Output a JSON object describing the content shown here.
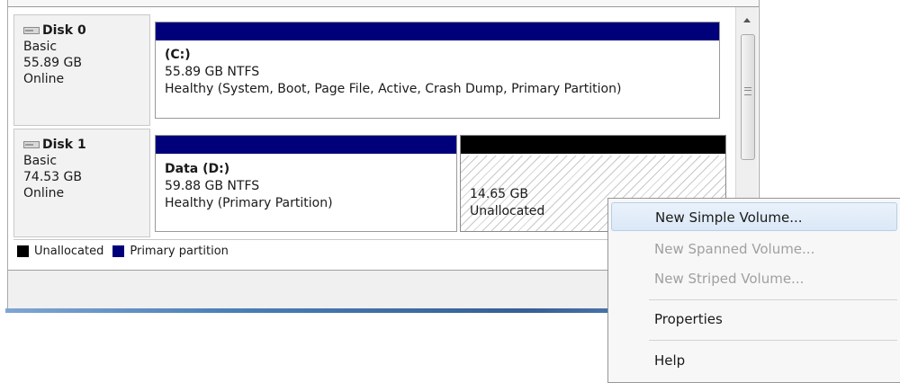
{
  "disks": [
    {
      "name": "Disk 0",
      "type": "Basic",
      "size": "55.89 GB",
      "status": "Online",
      "partitions": [
        {
          "title": "(C:)",
          "line2": "55.89 GB NTFS",
          "line3": "Healthy (System, Boot, Page File, Active, Crash Dump, Primary Partition)",
          "kind": "primary"
        }
      ]
    },
    {
      "name": "Disk 1",
      "type": "Basic",
      "size": "74.53 GB",
      "status": "Online",
      "partitions": [
        {
          "title": "Data  (D:)",
          "line2": "59.88 GB NTFS",
          "line3": "Healthy (Primary Partition)",
          "kind": "primary"
        },
        {
          "title": "",
          "line2": "14.65 GB",
          "line3": "Unallocated",
          "kind": "unallocated"
        }
      ]
    }
  ],
  "legend": [
    {
      "label": "Unallocated",
      "color": "#000000"
    },
    {
      "label": "Primary partition",
      "color": "#00007b"
    }
  ],
  "context_menu": {
    "items": [
      {
        "label": "New Simple Volume...",
        "enabled": true,
        "highlighted": true
      },
      {
        "label": "New Spanned Volume...",
        "enabled": false
      },
      {
        "label": "New Striped Volume...",
        "enabled": false
      },
      {
        "label": "Properties",
        "enabled": true
      },
      {
        "label": "Help",
        "enabled": true
      }
    ]
  },
  "icons": {
    "disk": "disk-drive-icon",
    "scroll_up": "scroll-up-arrow-icon"
  }
}
